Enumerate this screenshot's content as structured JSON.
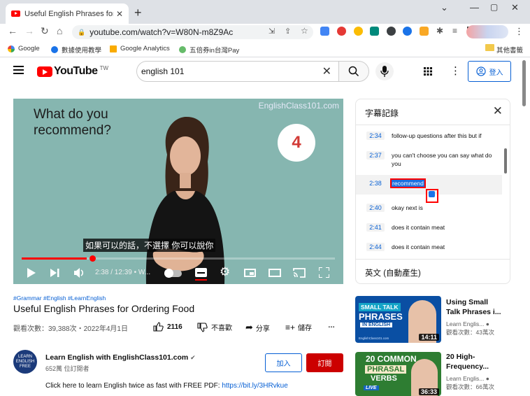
{
  "browser": {
    "tab_title": "Useful English Phrases for Orde",
    "url": "youtube.com/watch?v=W80N-m8Z9Ac",
    "bookmarks": [
      "Google",
      "數據使用教學",
      "Google Analytics",
      "五倍券in台灣Pay"
    ],
    "other_bookmarks": "其他書籤"
  },
  "header": {
    "logo": "YouTube",
    "country_code": "TW",
    "search_value": "english 101",
    "signin": "登入"
  },
  "video": {
    "overlay_text": "What do you\nrecommend?",
    "brand_watermark": "EnglishClass101.com",
    "step_number": "4",
    "subtitle": "如果可以的話，不選擇 你可以說你",
    "time": "2:38 / 12:39 • W..."
  },
  "transcript": {
    "heading": "字幕記錄",
    "language": "英文 (自動產生)",
    "segments": [
      {
        "ts": "2:34",
        "text": "follow-up questions after this but if"
      },
      {
        "ts": "2:37",
        "text": "you can't choose you can say what do you"
      },
      {
        "ts": "2:38",
        "text": "recommend"
      },
      {
        "ts": "2:40",
        "text": "okay next is"
      },
      {
        "ts": "2:41",
        "text": "does it contain meat"
      },
      {
        "ts": "2:44",
        "text": "does it contain meat"
      }
    ]
  },
  "info": {
    "hashtags": "#Grammar #English #LearnEnglish",
    "title": "Useful English Phrases for Ordering Food",
    "views": "觀看次數：39,388次・2022年4月1日",
    "likes": "2116",
    "dislike": "不喜歡",
    "share": "分享",
    "save": "儲存",
    "more": "…",
    "channel_avatar": "LEARN ENGLISH FREE",
    "channel": "Learn English with EnglishClass101.com",
    "subscribers": "652萬 位訂閱者",
    "join": "加入",
    "subscribe": "訂閱",
    "description": "Click here to learn English twice as fast with FREE PDF: ",
    "desc_link": "https://bit.ly/3HRvkue"
  },
  "related": [
    {
      "title": "Using Small Talk Phrases i...",
      "channel": "Learn Englis...",
      "views": "觀看次數：43萬次",
      "duration": "14:11",
      "thumb_line1": "SMALL TALK",
      "thumb_line2": "PHRASES",
      "thumb_line3": "IN ENGLISH",
      "thumb_brand": "EnglishClass101.com",
      "color": "#0a4fa3"
    },
    {
      "title": "20 High-Frequency...",
      "channel": "Learn Englis...",
      "views": "觀看次數：66萬次",
      "duration": "36:33",
      "thumb_line1": "20 COMMON",
      "thumb_line2": "PHRASAL",
      "thumb_line3": "VERBS",
      "thumb_line4": "LIVE",
      "color": "#2e7d32"
    }
  ]
}
